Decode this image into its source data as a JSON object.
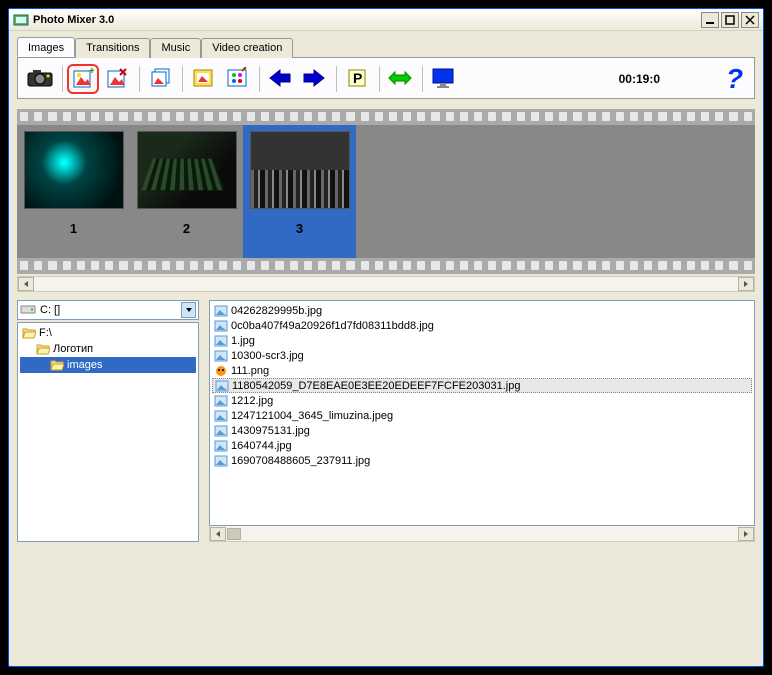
{
  "window": {
    "title": "Photo Mixer 3.0"
  },
  "tabs": [
    "Images",
    "Transitions",
    "Music",
    "Video creation"
  ],
  "active_tab": 0,
  "toolbar": {
    "timer": "00:19:0"
  },
  "frames": [
    {
      "num": "1"
    },
    {
      "num": "2"
    },
    {
      "num": "3"
    }
  ],
  "selected_frame": 2,
  "drive": {
    "label": "C: []"
  },
  "tree": [
    {
      "label": "F:\\",
      "depth": 0,
      "open": true
    },
    {
      "label": "Логотип",
      "depth": 1,
      "open": true
    },
    {
      "label": "images",
      "depth": 2,
      "open": true,
      "selected": true
    }
  ],
  "files": [
    {
      "name": "04262829995b.jpg",
      "kind": "img"
    },
    {
      "name": "0c0ba407f49a20926f1d7fd08311bdd8.jpg",
      "kind": "img"
    },
    {
      "name": "1.jpg",
      "kind": "img"
    },
    {
      "name": "10300-scr3.jpg",
      "kind": "img"
    },
    {
      "name": "111.png",
      "kind": "png"
    },
    {
      "name": "1180542059_D7E8EAE0E3EE20EDEEF7FCFE203031.jpg",
      "kind": "img",
      "selected": true
    },
    {
      "name": "1212.jpg",
      "kind": "img"
    },
    {
      "name": "1247121004_3645_limuzina.jpeg",
      "kind": "img"
    },
    {
      "name": "1430975131.jpg",
      "kind": "img"
    },
    {
      "name": "1640744.jpg",
      "kind": "img"
    },
    {
      "name": "1690708488605_237911.jpg",
      "kind": "img"
    }
  ]
}
